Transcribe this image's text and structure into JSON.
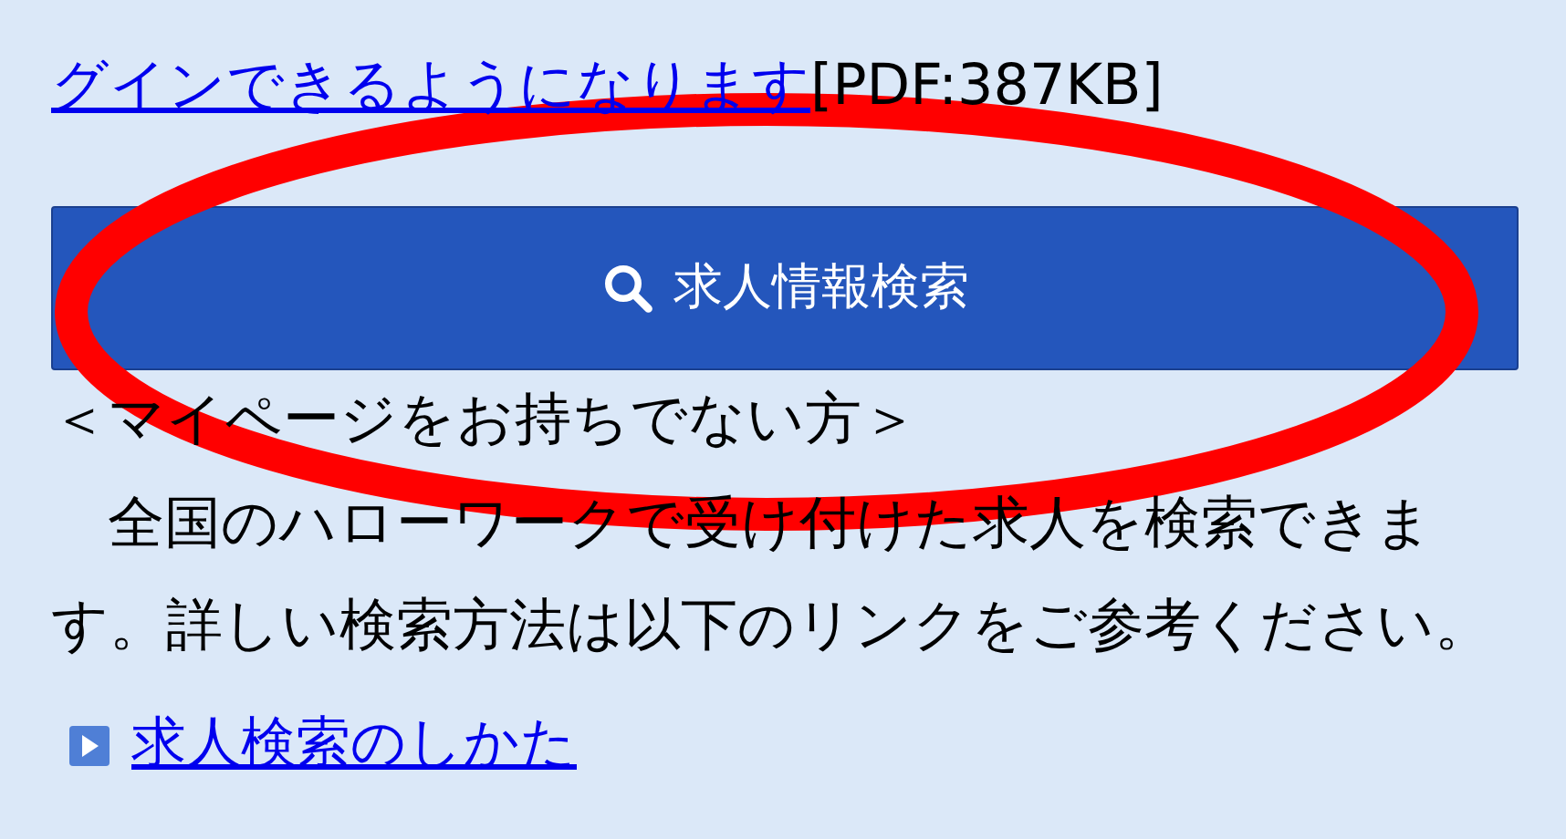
{
  "pdf_link": {
    "text": "グインできるようになります",
    "note": "[PDF:387KB]"
  },
  "search_button": {
    "label": "求人情報検索"
  },
  "heading": "＜マイページをお持ちでない方＞",
  "paragraph": "　全国のハローワークで受け付けた求人を検索できます。詳しい検索方法は以下のリンクをご参考ください。",
  "guide_link": {
    "text": "求人検索のしかた"
  }
}
